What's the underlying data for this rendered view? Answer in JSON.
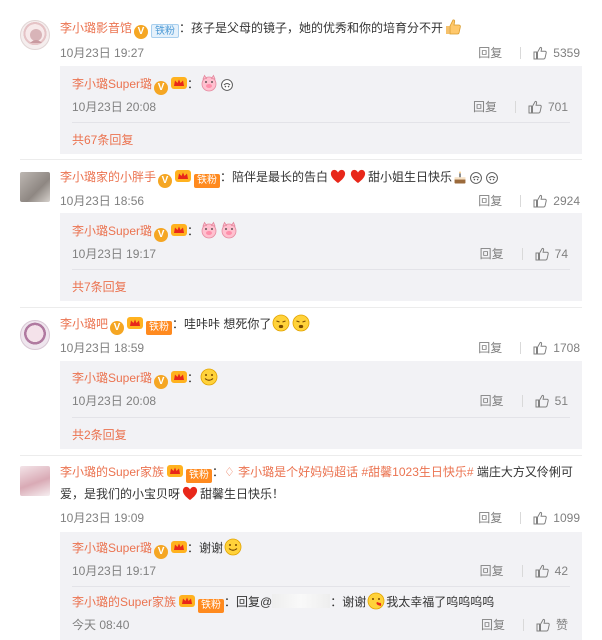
{
  "comments": [
    {
      "username": "李小璐影音馆",
      "fan_badge": "铁粉",
      "content": "：孩子是父母的镜子，她的优秀和你的培育分不开",
      "time": "10月23日 19:27",
      "reply_label": "回复",
      "likes": "5359",
      "reply": {
        "username": "李小璐Super璐",
        "content": "：",
        "time": "10月23日 20:08",
        "reply_label": "回复",
        "likes": "701"
      },
      "more": "共67条回复"
    },
    {
      "username": "李小璐家的小胖手",
      "fan_badge": "铁粉",
      "content": "：陪伴是最长的告白",
      "content_after": "甜小姐生日快乐",
      "time": "10月23日 18:56",
      "reply_label": "回复",
      "likes": "2924",
      "reply": {
        "username": "李小璐Super璐",
        "content": "：",
        "time": "10月23日 19:17",
        "reply_label": "回复",
        "likes": "74"
      },
      "more": "共7条回复"
    },
    {
      "username": "李小璐吧",
      "fan_badge": "铁粉",
      "content": "：哇咔咔 想死你了",
      "time": "10月23日 18:59",
      "reply_label": "回复",
      "likes": "1708",
      "reply": {
        "username": "李小璐Super璐",
        "content": "：",
        "time": "10月23日 20:08",
        "reply_label": "回复",
        "likes": "51"
      },
      "more": "共2条回复"
    },
    {
      "username": "李小璐的Super家族",
      "fan_badge": "铁粉",
      "content_pre": "：",
      "topic_at": "李小璐是个好妈妈超话",
      "topic_tag": "#甜馨1023生日快乐#",
      "content": " 端庄大方又伶俐可爱，是我们的小宝贝呀",
      "content_after": "甜馨生日快乐！",
      "time": "10月23日 19:09",
      "reply_label": "回复",
      "likes": "1099",
      "reply": {
        "username": "李小璐Super璐",
        "content": "：谢谢",
        "time": "10月23日 19:17",
        "reply_label": "回复",
        "likes": "42"
      },
      "reply2": {
        "username": "李小璐的Super家族",
        "fan_badge": "铁粉",
        "content_pre": "：回复@",
        "content": "：谢谢",
        "content_after": "我太幸福了呜呜呜呜",
        "time": "今天 08:40",
        "reply_label": "回复",
        "likes": "赞"
      }
    }
  ],
  "colors": {
    "username": "#eb7350",
    "meta": "#808080",
    "reply_bg": "#f2f2f5"
  },
  "icons": {
    "like": "thumbs-up-icon",
    "verified": "v-badge-icon",
    "crown": "crown-badge-icon"
  }
}
